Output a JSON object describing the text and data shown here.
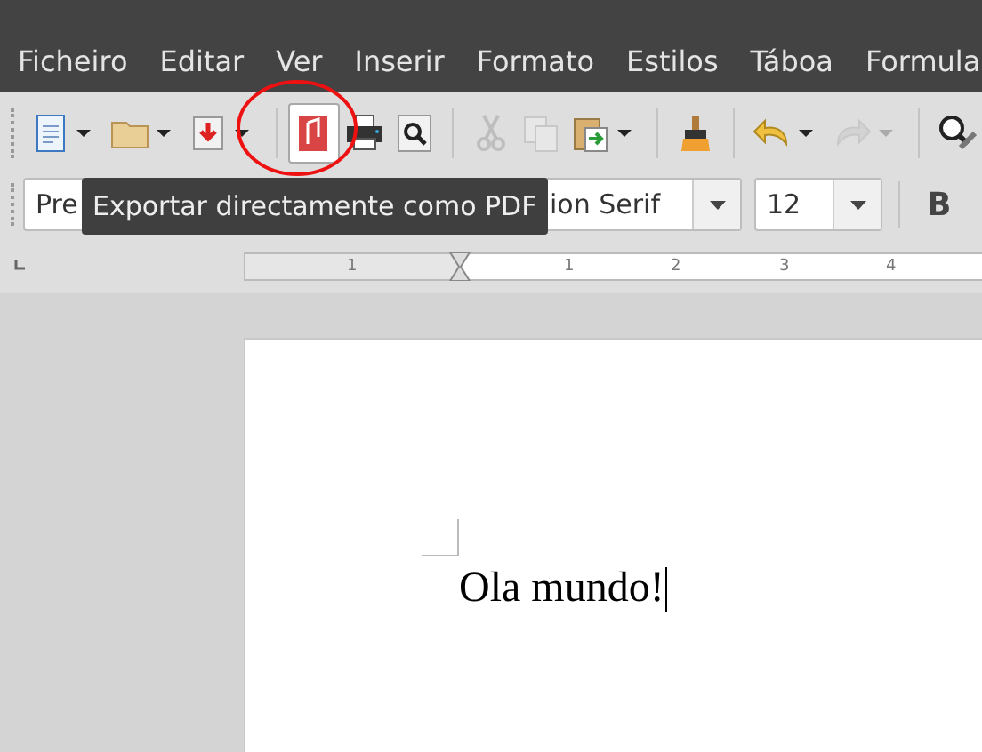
{
  "menu": [
    {
      "label": "Ficheiro"
    },
    {
      "label": "Editar"
    },
    {
      "label": "Ver"
    },
    {
      "label": "Inserir"
    },
    {
      "label": "Formato"
    },
    {
      "label": "Estilos"
    },
    {
      "label": "Táboa"
    },
    {
      "label": "Formula"
    }
  ],
  "toolbar": [
    {
      "kind": "new",
      "disabled": false,
      "pressed": false
    },
    {
      "kind": "arrow",
      "disabled": false
    },
    {
      "kind": "open",
      "disabled": false,
      "pressed": false
    },
    {
      "kind": "arrow",
      "disabled": false
    },
    {
      "kind": "save",
      "disabled": false,
      "pressed": false
    },
    {
      "kind": "arrow",
      "disabled": false
    },
    {
      "kind": "sep"
    },
    {
      "kind": "pdf",
      "disabled": false,
      "pressed": true
    },
    {
      "kind": "print",
      "disabled": false,
      "pressed": false
    },
    {
      "kind": "preview",
      "disabled": false,
      "pressed": false
    },
    {
      "kind": "sep"
    },
    {
      "kind": "cut",
      "disabled": true,
      "pressed": false
    },
    {
      "kind": "copy",
      "disabled": true,
      "pressed": false
    },
    {
      "kind": "paste",
      "disabled": false,
      "pressed": false
    },
    {
      "kind": "arrow",
      "disabled": false
    },
    {
      "kind": "sep"
    },
    {
      "kind": "brush",
      "disabled": false,
      "pressed": false
    },
    {
      "kind": "sep"
    },
    {
      "kind": "undo",
      "disabled": false,
      "pressed": false
    },
    {
      "kind": "arrow",
      "disabled": false
    },
    {
      "kind": "redo",
      "disabled": true,
      "pressed": false
    },
    {
      "kind": "arrow",
      "disabled": true
    },
    {
      "kind": "sep"
    },
    {
      "kind": "find",
      "disabled": false,
      "pressed": false
    }
  ],
  "format_bar": {
    "paragraph_style": "Pre",
    "font_name": "ion Serif",
    "font_size": "12",
    "bold_button": "B"
  },
  "tooltip": "Exportar directamente como PDF",
  "ruler": {
    "labels": [
      "1",
      "1",
      "2",
      "3",
      "4"
    ]
  },
  "document": {
    "text": "Ola mundo!"
  }
}
